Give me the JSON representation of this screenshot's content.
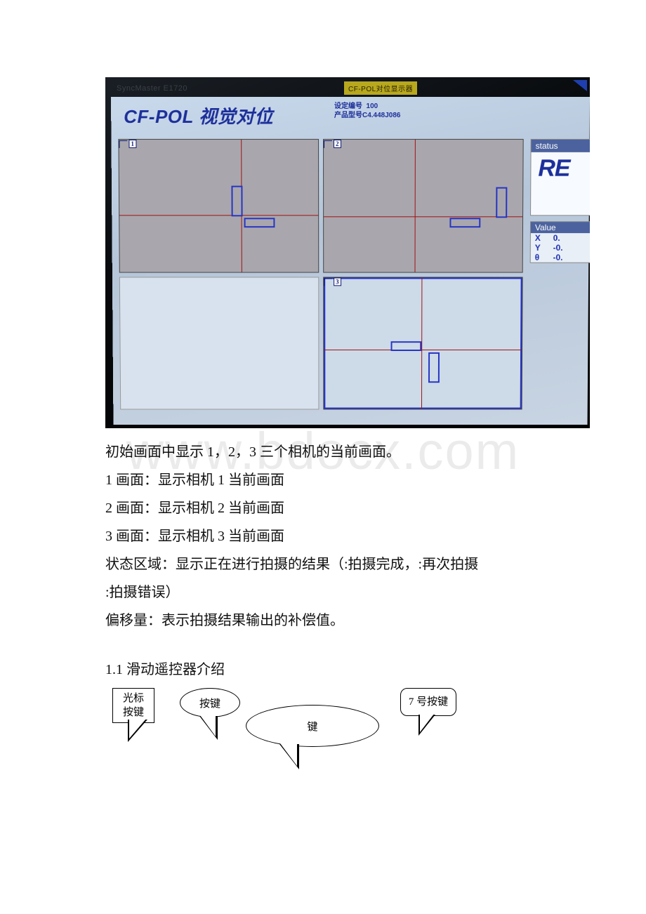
{
  "screenshot": {
    "monitor_brand": "SyncMaster E1720",
    "bezel_label": "CF-POL对位显示器",
    "title": "CF-POL 视觉对位",
    "info_line1": "设定编号  100",
    "info_line2": "产品型号C4.448J086",
    "cam_labels": {
      "c1": "1",
      "c2": "2",
      "c3": "3"
    },
    "status": {
      "header": "status",
      "value": "RE"
    },
    "values": {
      "header": "Value",
      "rows": [
        {
          "label": "X",
          "val": "0."
        },
        {
          "label": "Y",
          "val": "-0."
        },
        {
          "label": "θ",
          "val": "-0."
        }
      ]
    }
  },
  "body": {
    "p1": "初始画面中显示 1，2，3 三个相机的当前画面。",
    "p2": "1 画面：显示相机 1 当前画面",
    "p3": "2 画面：显示相机 2 当前画面",
    "p4": "3 画面：显示相机 3 当前画面",
    "p5": "状态区域：显示正在进行拍摄的结果（:拍摄完成，:再次拍摄",
    "p6": ":拍摄错误）",
    "p7": "偏移量：表示拍摄结果输出的补偿值。",
    "sec": "1.1 滑动遥控器介绍",
    "callouts": {
      "c1a": "光标",
      "c1b": "按键",
      "c2": "按键",
      "c3": "键",
      "c4": "7 号按键"
    }
  },
  "watermark": "www.bdocx.com"
}
